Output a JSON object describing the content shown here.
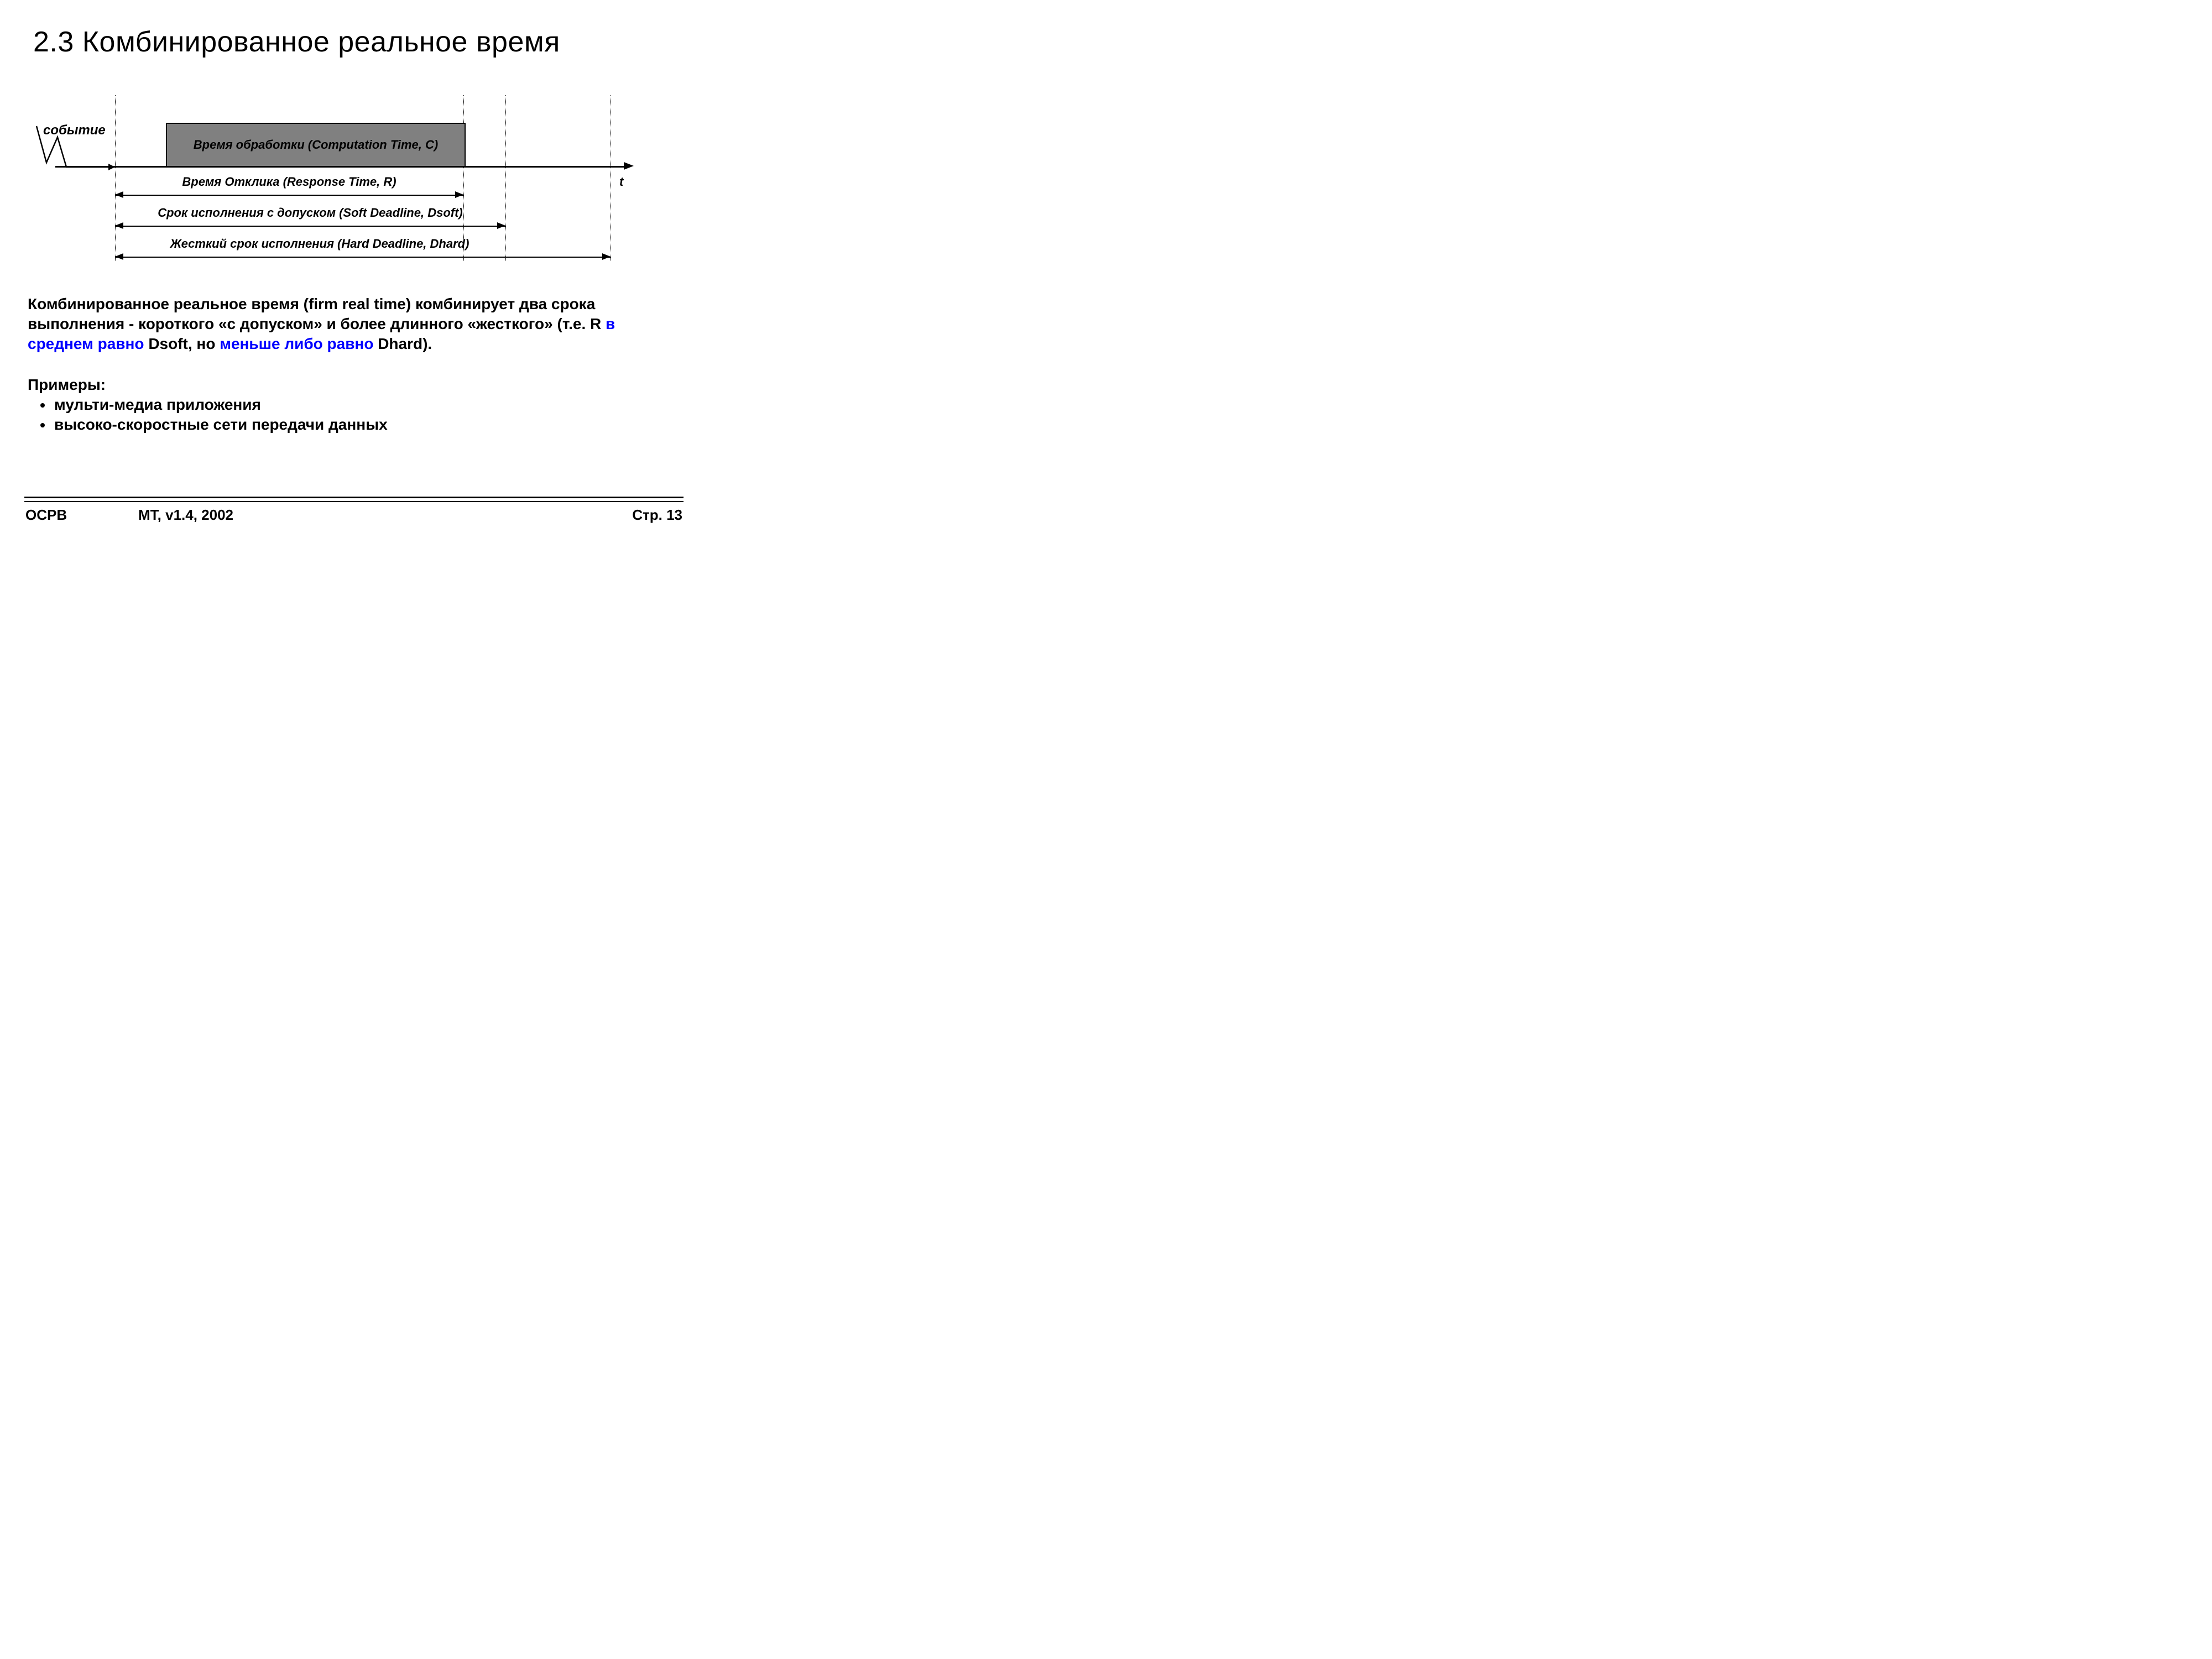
{
  "title": "2.3 Комбинированное реальное время",
  "diagram": {
    "event_label": "событие",
    "computation_box": "Время обработки (Computation Time, C)",
    "axis_label": "t",
    "dimensions": {
      "response": "Время Отклика (Response Time, R)",
      "soft": "Срок  исполнения с допуском (Soft Deadline, Dsoft)",
      "hard": "Жесткий срок  исполнения (Hard Deadline, Dhard)"
    }
  },
  "paragraph": {
    "p1": "Комбинированное реальное время (firm real time) комбинирует два срока выполнения - короткого «с допуском» и более длинного «жесткого» (т.е. R ",
    "blue1": "в среднем равно",
    "p2": " Dsoft, но ",
    "blue2": "меньше либо равно",
    "p3": " Dhard)."
  },
  "examples_header": "Примеры:",
  "examples": [
    "мульти-медиа приложения",
    "высоко-скоростные сети передачи данных"
  ],
  "footer": {
    "left": "ОСРВ",
    "center": "MT, v1.4, 2002",
    "right": "Стр. 13"
  }
}
